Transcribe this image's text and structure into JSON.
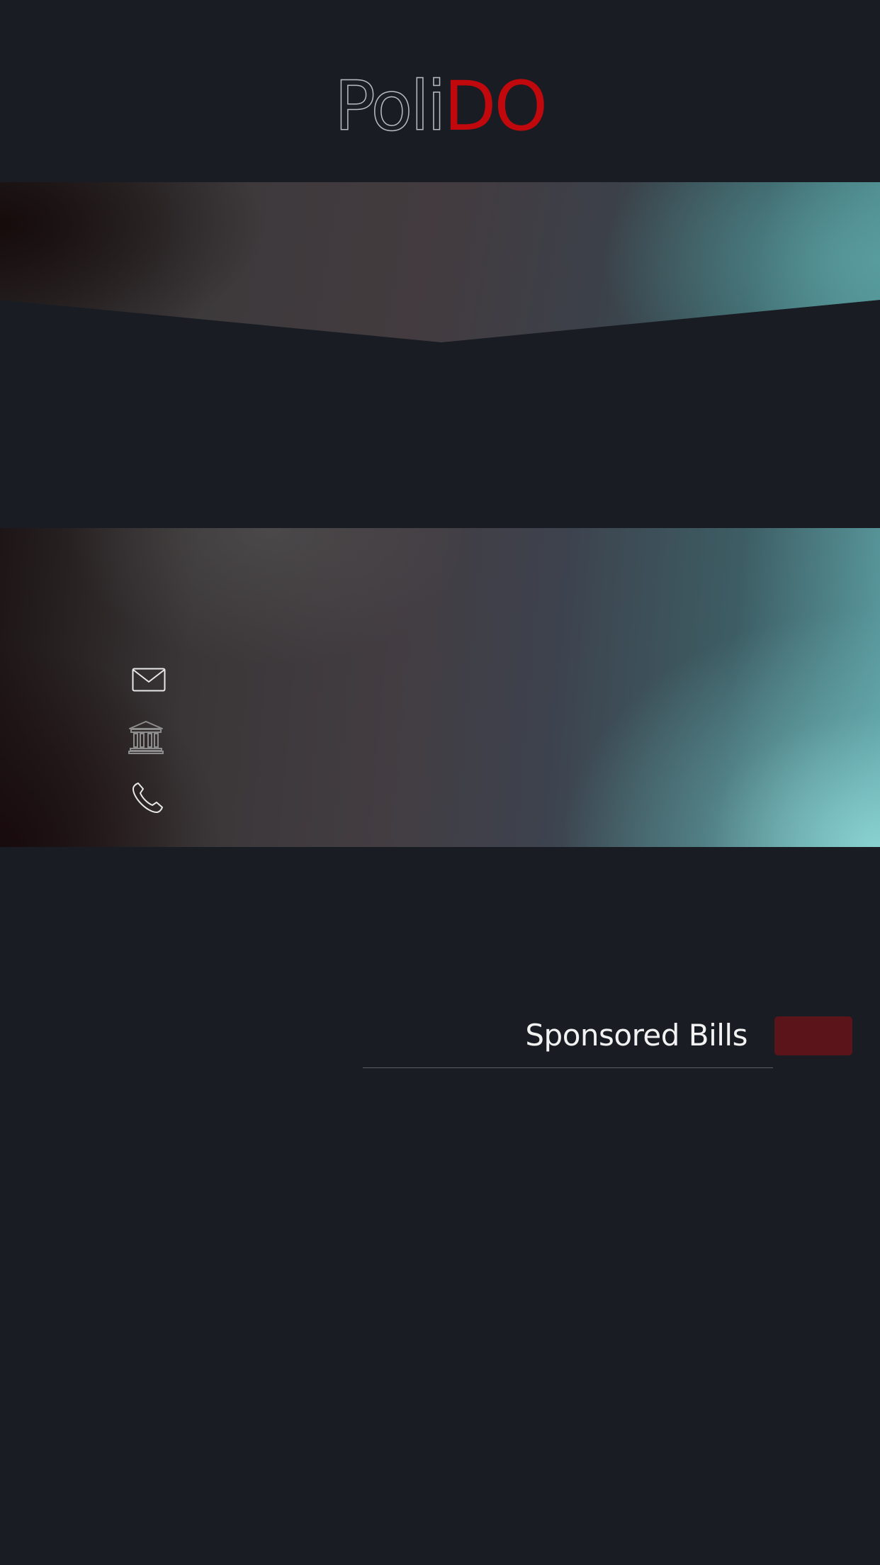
{
  "app": {
    "logo_part1": "Poli",
    "logo_part2": "DO"
  },
  "colors": {
    "background": "#191d23",
    "accent_red": "#c0080d",
    "button_red": "#5a141a",
    "teal": "#5ca0a2"
  },
  "contact": {
    "icons": [
      "mail-icon",
      "building-icon",
      "phone-icon"
    ]
  },
  "bills_section": {
    "title": "Sponsored Bills"
  }
}
